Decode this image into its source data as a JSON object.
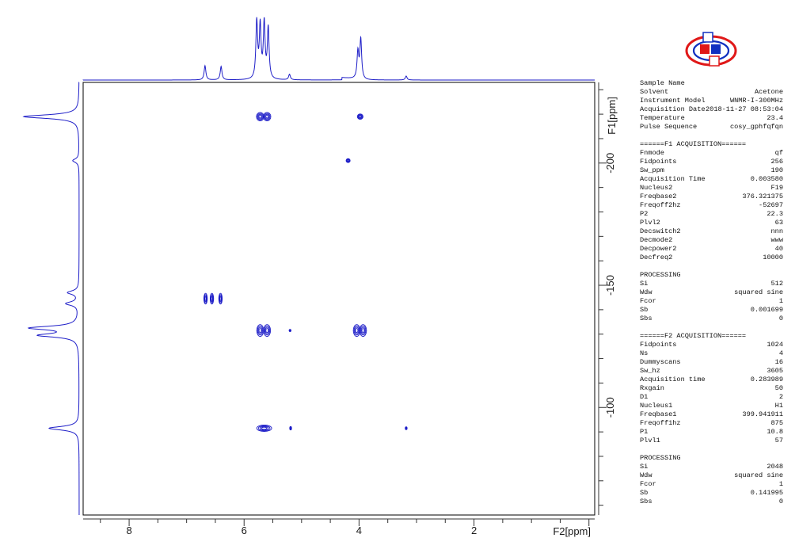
{
  "chart_data": {
    "type": "contour",
    "xlabel": "F2[ppm]",
    "ylabel": "F1[ppm]",
    "x_ticks": [
      8,
      6,
      4,
      2
    ],
    "y_ticks": [
      -200,
      -150,
      -100
    ],
    "xlim": [
      8.8,
      -0.1
    ],
    "ylim": [
      -233,
      -56
    ],
    "peaks": [
      {
        "x": 5.72,
        "y": -219,
        "w": 0.13,
        "h": 3.4
      },
      {
        "x": 5.6,
        "y": -219,
        "w": 0.13,
        "h": 3.4
      },
      {
        "x": 3.98,
        "y": -219,
        "w": 0.1,
        "h": 2.2
      },
      {
        "x": 4.19,
        "y": -201,
        "w": 0.07,
        "h": 1.6
      },
      {
        "x": 6.67,
        "y": -144.5,
        "w": 0.06,
        "h": 4.4
      },
      {
        "x": 6.56,
        "y": -144.5,
        "w": 0.06,
        "h": 4.4
      },
      {
        "x": 6.41,
        "y": -144.5,
        "w": 0.06,
        "h": 4.4
      },
      {
        "x": 5.72,
        "y": -131.5,
        "w": 0.12,
        "h": 4.8
      },
      {
        "x": 5.6,
        "y": -131.5,
        "w": 0.12,
        "h": 4.8
      },
      {
        "x": 5.2,
        "y": -131.5,
        "w": 0.02,
        "h": 0.9
      },
      {
        "x": 4.04,
        "y": -131.5,
        "w": 0.12,
        "h": 4.8
      },
      {
        "x": 3.93,
        "y": -131.5,
        "w": 0.12,
        "h": 4.8
      },
      {
        "x": 5.65,
        "y": -91.5,
        "w": 0.26,
        "h": 2.6
      },
      {
        "x": 5.19,
        "y": -91.5,
        "w": 0.03,
        "h": 1.4
      },
      {
        "x": 3.18,
        "y": -91.5,
        "w": 0.02,
        "h": 1.2
      }
    ],
    "f2_projection": [
      {
        "x": 6.68,
        "h": 18
      },
      {
        "x": 6.4,
        "h": 17
      },
      {
        "x": 5.78,
        "h": 72
      },
      {
        "x": 5.72,
        "h": 66
      },
      {
        "x": 5.65,
        "h": 70
      },
      {
        "x": 5.58,
        "h": 64
      },
      {
        "x": 5.21,
        "h": 7
      },
      {
        "x": 4.02,
        "h": 34
      },
      {
        "x": 3.97,
        "h": 50
      },
      {
        "x": 3.18,
        "h": 5
      }
    ],
    "f1_projection": [
      {
        "y": -219,
        "h": 70
      },
      {
        "y": -201,
        "h": 8
      },
      {
        "y": -147,
        "h": 14
      },
      {
        "y": -142.5,
        "h": 16
      },
      {
        "y": -132.5,
        "h": 60
      },
      {
        "y": -129.5,
        "h": 48
      },
      {
        "y": -91.5,
        "h": 38
      }
    ],
    "colors": {
      "contour": "#1e1ec8",
      "axis": "#333333"
    }
  },
  "parameters": {
    "sample": [
      {
        "label": "Sample Name",
        "value": ""
      },
      {
        "label": "Solvent",
        "value": "Acetone"
      },
      {
        "label": "Instrument Model",
        "value": "WNMR-I-300MHz"
      },
      {
        "label": "Acquisition Date",
        "value": "2018-11-27 08:53:04"
      },
      {
        "label": "Temperature",
        "value": "23.4"
      },
      {
        "label": "Pulse Sequence",
        "value": "cosy_gphfqfqn"
      }
    ],
    "f1_header": "======F1 ACQUISITION======",
    "f1": [
      {
        "label": "Fnmode",
        "value": "qf"
      },
      {
        "label": "Fidpoints",
        "value": "256"
      },
      {
        "label": "Sw_ppm",
        "value": "190"
      },
      {
        "label": "Acquisition Time",
        "value": "0.003580"
      },
      {
        "label": "Nucleus2",
        "value": "F19"
      },
      {
        "label": "Freqbase2",
        "value": "376.321375"
      },
      {
        "label": "Freqoff2hz",
        "value": "-52697"
      },
      {
        "label": "P2",
        "value": "22.3"
      },
      {
        "label": "Plvl2",
        "value": "63"
      },
      {
        "label": "Decswitch2",
        "value": "nnn"
      },
      {
        "label": "Decmode2",
        "value": "www"
      },
      {
        "label": "Decpower2",
        "value": "40"
      },
      {
        "label": "Decfreq2",
        "value": "10000"
      }
    ],
    "proc1_header": "PROCESSING",
    "proc1": [
      {
        "label": "Si",
        "value": "512"
      },
      {
        "label": "Wdw",
        "value": "squared sine"
      },
      {
        "label": "Fcor",
        "value": "1"
      },
      {
        "label": "Sb",
        "value": "0.001699"
      },
      {
        "label": "Sbs",
        "value": "0"
      }
    ],
    "f2_header": "======F2 ACQUISITION======",
    "f2": [
      {
        "label": "Fidpoints",
        "value": "1024"
      },
      {
        "label": "Ns",
        "value": "4"
      },
      {
        "label": "Dummyscans",
        "value": "16"
      },
      {
        "label": "Sw_hz",
        "value": "3605"
      },
      {
        "label": "Acquisition time",
        "value": "0.283989"
      },
      {
        "label": "Rxgain",
        "value": "50"
      },
      {
        "label": "D1",
        "value": "2"
      },
      {
        "label": "Nucleus1",
        "value": "H1"
      },
      {
        "label": "Freqbase1",
        "value": "399.941911"
      },
      {
        "label": "Freqoff1hz",
        "value": "875"
      },
      {
        "label": "P1",
        "value": "10.8"
      },
      {
        "label": "Plvl1",
        "value": "57"
      }
    ],
    "proc2_header": "PROCESSING",
    "proc2": [
      {
        "label": "Si",
        "value": "2048"
      },
      {
        "label": "Wdw",
        "value": "squared sine"
      },
      {
        "label": "Fcor",
        "value": "1"
      },
      {
        "label": "Sb",
        "value": "0.141995"
      },
      {
        "label": "Sbs",
        "value": "0"
      }
    ]
  }
}
